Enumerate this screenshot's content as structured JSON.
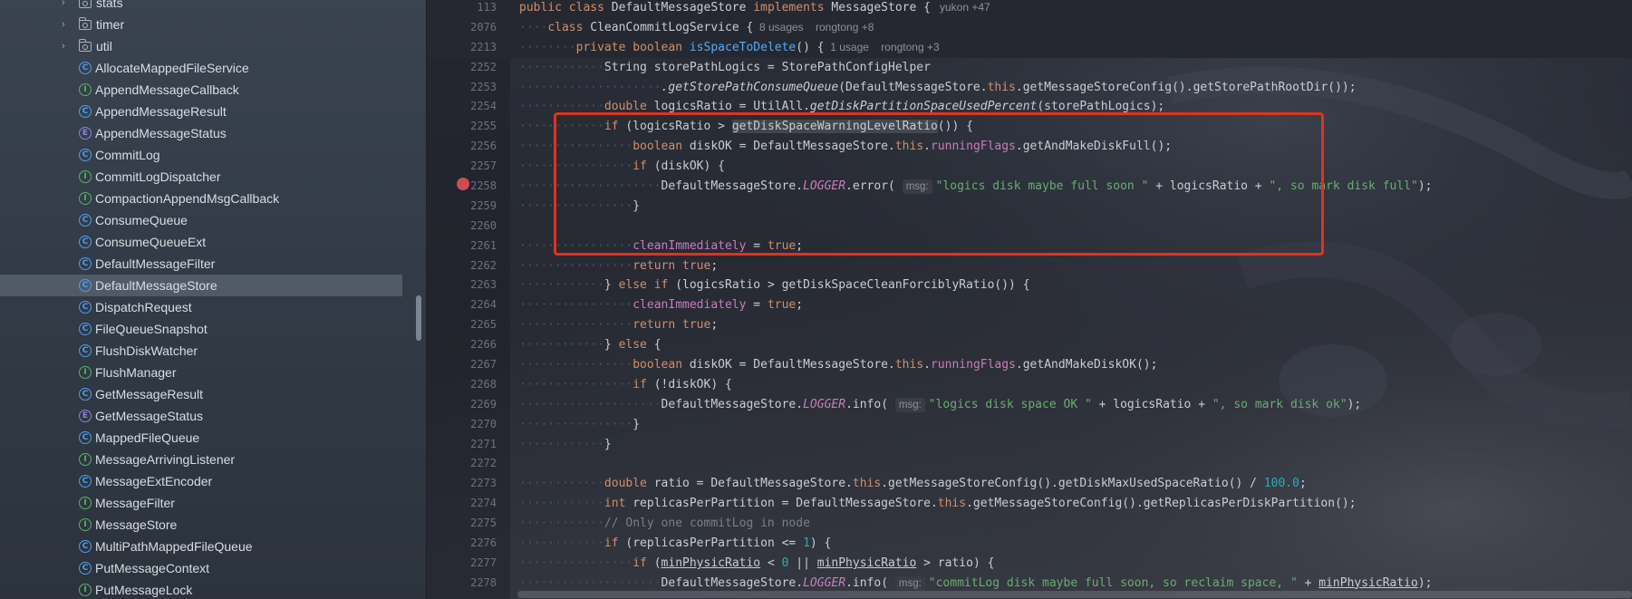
{
  "project_tree": {
    "items": [
      {
        "kind": "folder",
        "label": "stats",
        "expanded": false
      },
      {
        "kind": "folder",
        "label": "timer",
        "expanded": false
      },
      {
        "kind": "folder",
        "label": "util",
        "expanded": false
      },
      {
        "kind": "C",
        "label": "AllocateMappedFileService"
      },
      {
        "kind": "I",
        "label": "AppendMessageCallback"
      },
      {
        "kind": "C",
        "label": "AppendMessageResult"
      },
      {
        "kind": "E",
        "label": "AppendMessageStatus"
      },
      {
        "kind": "C",
        "label": "CommitLog"
      },
      {
        "kind": "I",
        "label": "CommitLogDispatcher"
      },
      {
        "kind": "I",
        "label": "CompactionAppendMsgCallback"
      },
      {
        "kind": "C",
        "label": "ConsumeQueue"
      },
      {
        "kind": "C",
        "label": "ConsumeQueueExt"
      },
      {
        "kind": "C",
        "label": "DefaultMessageFilter"
      },
      {
        "kind": "C",
        "label": "DefaultMessageStore",
        "selected": true
      },
      {
        "kind": "C",
        "label": "DispatchRequest"
      },
      {
        "kind": "C",
        "label": "FileQueueSnapshot"
      },
      {
        "kind": "C",
        "label": "FlushDiskWatcher"
      },
      {
        "kind": "I",
        "label": "FlushManager"
      },
      {
        "kind": "C",
        "label": "GetMessageResult"
      },
      {
        "kind": "E",
        "label": "GetMessageStatus"
      },
      {
        "kind": "C",
        "label": "MappedFileQueue"
      },
      {
        "kind": "I",
        "label": "MessageArrivingListener"
      },
      {
        "kind": "C",
        "label": "MessageExtEncoder"
      },
      {
        "kind": "I",
        "label": "MessageFilter"
      },
      {
        "kind": "I",
        "label": "MessageStore"
      },
      {
        "kind": "C",
        "label": "MultiPathMappedFileQueue"
      },
      {
        "kind": "C",
        "label": "PutMessageContext"
      },
      {
        "kind": "I",
        "label": "PutMessageLock"
      }
    ]
  },
  "icons": {
    "folder": "folder-icon",
    "C": "class-icon",
    "I": "interface-icon",
    "E": "enum-icon",
    "breakpoint": "breakpoint-icon"
  },
  "colors": {
    "keyword": "#cf8e6d",
    "method": "#56a8f5",
    "string": "#6aab73",
    "number": "#2aacb8",
    "field": "#c77dbb",
    "highlight_box": "#e0321f",
    "breakpoint": "#c94f4f"
  },
  "editor": {
    "sticky_lines": [
      {
        "no": "113",
        "indent": "",
        "tokens": [
          [
            "kw",
            "public class "
          ],
          [
            "",
            "DefaultMessageStore "
          ],
          [
            "kw",
            "implements "
          ],
          [
            "",
            "MessageStore {"
          ],
          [
            "hint",
            "   yukon +47"
          ]
        ]
      },
      {
        "no": "2076",
        "indent": "····",
        "tokens": [
          [
            "kw",
            "class "
          ],
          [
            "",
            "CleanCommitLogService {"
          ],
          [
            "hint",
            "  8 usages    rongtong +8"
          ]
        ]
      },
      {
        "no": "2213",
        "indent": "········",
        "tokens": [
          [
            "kw",
            "private boolean "
          ],
          [
            "fn",
            "isSpaceToDelete"
          ],
          [
            "",
            "() {"
          ],
          [
            "hint",
            "  1 usage    rongtong +3"
          ]
        ]
      }
    ],
    "lines": [
      {
        "no": "2252",
        "indent": "············",
        "tokens": [
          [
            "",
            "String storePathLogics = StorePathConfigHelper"
          ]
        ]
      },
      {
        "no": "2253",
        "indent": "····················",
        "tokens": [
          [
            "ital",
            ".getStorePathConsumeQueue"
          ],
          [
            "",
            "(DefaultMessageStore."
          ],
          [
            "kw",
            "this"
          ],
          [
            "",
            ".getMessageStoreConfig().getStorePathRootDir());"
          ]
        ]
      },
      {
        "no": "2254",
        "indent": "············",
        "tokens": [
          [
            "kw",
            "double "
          ],
          [
            "",
            "logicsRatio = UtilAll."
          ],
          [
            "ital",
            "getDiskPartitionSpaceUsedPercent"
          ],
          [
            "",
            "(storePathLogics);"
          ]
        ]
      },
      {
        "no": "2255",
        "indent": "············",
        "tokens": [
          [
            "kw",
            "if "
          ],
          [
            "",
            "(logicsRatio > "
          ],
          [
            "hl",
            "getDiskSpaceWarningLevelRatio"
          ],
          [
            "",
            "()) {"
          ]
        ]
      },
      {
        "no": "2256",
        "indent": "················",
        "tokens": [
          [
            "kw",
            "boolean "
          ],
          [
            "",
            "diskOK = DefaultMessageStore."
          ],
          [
            "kw",
            "this"
          ],
          [
            "",
            "."
          ],
          [
            "fld",
            "runningFlags"
          ],
          [
            "",
            ".getAndMakeDiskFull();"
          ]
        ]
      },
      {
        "no": "2257",
        "indent": "················",
        "tokens": [
          [
            "kw",
            "if "
          ],
          [
            "",
            "(diskOK) {"
          ]
        ]
      },
      {
        "no": "2258",
        "indent": "····················",
        "breakpoint": true,
        "tokens": [
          [
            "",
            "DefaultMessageStore."
          ],
          [
            "fld-ital",
            "LOGGER"
          ],
          [
            "",
            ".error( "
          ],
          [
            "param",
            "msg:"
          ],
          [
            "str",
            "\"logics disk maybe full soon \""
          ],
          [
            "",
            " + logicsRatio + "
          ],
          [
            "str",
            "\", so mark disk full\""
          ],
          [
            "",
            ");"
          ]
        ]
      },
      {
        "no": "2259",
        "indent": "················",
        "tokens": [
          [
            "",
            "}"
          ]
        ]
      },
      {
        "no": "2260",
        "indent": "",
        "tokens": []
      },
      {
        "no": "2261",
        "indent": "················",
        "tokens": [
          [
            "fld",
            "cleanImmediately"
          ],
          [
            "",
            " = "
          ],
          [
            "kw",
            "true"
          ],
          [
            "",
            ";"
          ]
        ]
      },
      {
        "no": "2262",
        "indent": "················",
        "tokens": [
          [
            "kw",
            "return true"
          ],
          [
            "",
            ";"
          ]
        ]
      },
      {
        "no": "2263",
        "indent": "············",
        "tokens": [
          [
            "",
            "} "
          ],
          [
            "kw",
            "else if "
          ],
          [
            "",
            "(logicsRatio > getDiskSpaceCleanForciblyRatio()) {"
          ]
        ]
      },
      {
        "no": "2264",
        "indent": "················",
        "tokens": [
          [
            "fld",
            "cleanImmediately"
          ],
          [
            "",
            " = "
          ],
          [
            "kw",
            "true"
          ],
          [
            "",
            ";"
          ]
        ]
      },
      {
        "no": "2265",
        "indent": "················",
        "tokens": [
          [
            "kw",
            "return true"
          ],
          [
            "",
            ";"
          ]
        ]
      },
      {
        "no": "2266",
        "indent": "············",
        "tokens": [
          [
            "",
            "} "
          ],
          [
            "kw",
            "else "
          ],
          [
            "",
            "{"
          ]
        ]
      },
      {
        "no": "2267",
        "indent": "················",
        "tokens": [
          [
            "kw",
            "boolean "
          ],
          [
            "",
            "diskOK = DefaultMessageStore."
          ],
          [
            "kw",
            "this"
          ],
          [
            "",
            "."
          ],
          [
            "fld",
            "runningFlags"
          ],
          [
            "",
            ".getAndMakeDiskOK();"
          ]
        ]
      },
      {
        "no": "2268",
        "indent": "················",
        "tokens": [
          [
            "kw",
            "if "
          ],
          [
            "",
            "(!diskOK) {"
          ]
        ]
      },
      {
        "no": "2269",
        "indent": "····················",
        "tokens": [
          [
            "",
            "DefaultMessageStore."
          ],
          [
            "fld-ital",
            "LOGGER"
          ],
          [
            "",
            ".info( "
          ],
          [
            "param",
            "msg:"
          ],
          [
            "str",
            "\"logics disk space OK \""
          ],
          [
            "",
            " + logicsRatio + "
          ],
          [
            "str",
            "\", so mark disk ok\""
          ],
          [
            "",
            ");"
          ]
        ]
      },
      {
        "no": "2270",
        "indent": "················",
        "tokens": [
          [
            "",
            "}"
          ]
        ]
      },
      {
        "no": "2271",
        "indent": "············",
        "tokens": [
          [
            "",
            "}"
          ]
        ]
      },
      {
        "no": "2272",
        "indent": "",
        "tokens": []
      },
      {
        "no": "2273",
        "indent": "············",
        "tokens": [
          [
            "kw",
            "double "
          ],
          [
            "",
            "ratio = DefaultMessageStore."
          ],
          [
            "kw",
            "this"
          ],
          [
            "",
            ".getMessageStoreConfig().getDiskMaxUsedSpaceRatio() / "
          ],
          [
            "num",
            "100.0"
          ],
          [
            "",
            ";"
          ]
        ]
      },
      {
        "no": "2274",
        "indent": "············",
        "tokens": [
          [
            "kw",
            "int "
          ],
          [
            "",
            "replicasPerPartition = DefaultMessageStore."
          ],
          [
            "kw",
            "this"
          ],
          [
            "",
            ".getMessageStoreConfig().getReplicasPerDiskPartition();"
          ]
        ]
      },
      {
        "no": "2275",
        "indent": "············",
        "tokens": [
          [
            "cmt",
            "// Only one commitLog in node"
          ]
        ]
      },
      {
        "no": "2276",
        "indent": "············",
        "tokens": [
          [
            "kw",
            "if "
          ],
          [
            "",
            "(replicasPerPartition <= "
          ],
          [
            "num",
            "1"
          ],
          [
            "",
            ") {"
          ]
        ]
      },
      {
        "no": "2277",
        "indent": "················",
        "tokens": [
          [
            "kw",
            "if "
          ],
          [
            "",
            "("
          ],
          [
            "ul",
            "minPhysicRatio"
          ],
          [
            "",
            " < "
          ],
          [
            "num",
            "0"
          ],
          [
            "",
            " || "
          ],
          [
            "ul",
            "minPhysicRatio"
          ],
          [
            "",
            " > ratio) {"
          ]
        ]
      },
      {
        "no": "2278",
        "indent": "····················",
        "tokens": [
          [
            "",
            "DefaultMessageStore."
          ],
          [
            "fld-ital",
            "LOGGER"
          ],
          [
            "",
            ".info( "
          ],
          [
            "param",
            "msg:"
          ],
          [
            "str",
            "\"commitLog disk maybe full soon, so reclaim space, \""
          ],
          [
            "",
            " + "
          ],
          [
            "ul",
            "minPhysicRatio"
          ],
          [
            "",
            ");"
          ]
        ]
      }
    ]
  }
}
